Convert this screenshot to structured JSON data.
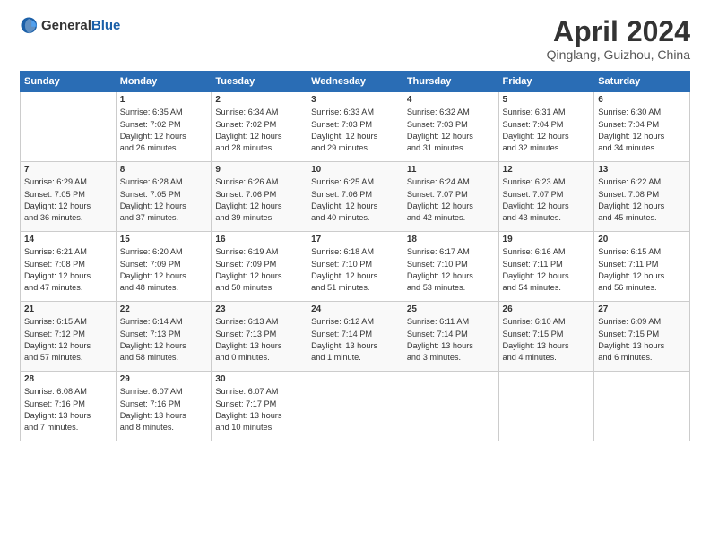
{
  "header": {
    "logo_general": "General",
    "logo_blue": "Blue",
    "title": "April 2024",
    "location": "Qinglang, Guizhou, China"
  },
  "columns": [
    "Sunday",
    "Monday",
    "Tuesday",
    "Wednesday",
    "Thursday",
    "Friday",
    "Saturday"
  ],
  "weeks": [
    {
      "days": [
        {
          "num": "",
          "info": ""
        },
        {
          "num": "1",
          "info": "Sunrise: 6:35 AM\nSunset: 7:02 PM\nDaylight: 12 hours\nand 26 minutes."
        },
        {
          "num": "2",
          "info": "Sunrise: 6:34 AM\nSunset: 7:02 PM\nDaylight: 12 hours\nand 28 minutes."
        },
        {
          "num": "3",
          "info": "Sunrise: 6:33 AM\nSunset: 7:03 PM\nDaylight: 12 hours\nand 29 minutes."
        },
        {
          "num": "4",
          "info": "Sunrise: 6:32 AM\nSunset: 7:03 PM\nDaylight: 12 hours\nand 31 minutes."
        },
        {
          "num": "5",
          "info": "Sunrise: 6:31 AM\nSunset: 7:04 PM\nDaylight: 12 hours\nand 32 minutes."
        },
        {
          "num": "6",
          "info": "Sunrise: 6:30 AM\nSunset: 7:04 PM\nDaylight: 12 hours\nand 34 minutes."
        }
      ]
    },
    {
      "days": [
        {
          "num": "7",
          "info": "Sunrise: 6:29 AM\nSunset: 7:05 PM\nDaylight: 12 hours\nand 36 minutes."
        },
        {
          "num": "8",
          "info": "Sunrise: 6:28 AM\nSunset: 7:05 PM\nDaylight: 12 hours\nand 37 minutes."
        },
        {
          "num": "9",
          "info": "Sunrise: 6:26 AM\nSunset: 7:06 PM\nDaylight: 12 hours\nand 39 minutes."
        },
        {
          "num": "10",
          "info": "Sunrise: 6:25 AM\nSunset: 7:06 PM\nDaylight: 12 hours\nand 40 minutes."
        },
        {
          "num": "11",
          "info": "Sunrise: 6:24 AM\nSunset: 7:07 PM\nDaylight: 12 hours\nand 42 minutes."
        },
        {
          "num": "12",
          "info": "Sunrise: 6:23 AM\nSunset: 7:07 PM\nDaylight: 12 hours\nand 43 minutes."
        },
        {
          "num": "13",
          "info": "Sunrise: 6:22 AM\nSunset: 7:08 PM\nDaylight: 12 hours\nand 45 minutes."
        }
      ]
    },
    {
      "days": [
        {
          "num": "14",
          "info": "Sunrise: 6:21 AM\nSunset: 7:08 PM\nDaylight: 12 hours\nand 47 minutes."
        },
        {
          "num": "15",
          "info": "Sunrise: 6:20 AM\nSunset: 7:09 PM\nDaylight: 12 hours\nand 48 minutes."
        },
        {
          "num": "16",
          "info": "Sunrise: 6:19 AM\nSunset: 7:09 PM\nDaylight: 12 hours\nand 50 minutes."
        },
        {
          "num": "17",
          "info": "Sunrise: 6:18 AM\nSunset: 7:10 PM\nDaylight: 12 hours\nand 51 minutes."
        },
        {
          "num": "18",
          "info": "Sunrise: 6:17 AM\nSunset: 7:10 PM\nDaylight: 12 hours\nand 53 minutes."
        },
        {
          "num": "19",
          "info": "Sunrise: 6:16 AM\nSunset: 7:11 PM\nDaylight: 12 hours\nand 54 minutes."
        },
        {
          "num": "20",
          "info": "Sunrise: 6:15 AM\nSunset: 7:11 PM\nDaylight: 12 hours\nand 56 minutes."
        }
      ]
    },
    {
      "days": [
        {
          "num": "21",
          "info": "Sunrise: 6:15 AM\nSunset: 7:12 PM\nDaylight: 12 hours\nand 57 minutes."
        },
        {
          "num": "22",
          "info": "Sunrise: 6:14 AM\nSunset: 7:13 PM\nDaylight: 12 hours\nand 58 minutes."
        },
        {
          "num": "23",
          "info": "Sunrise: 6:13 AM\nSunset: 7:13 PM\nDaylight: 13 hours\nand 0 minutes."
        },
        {
          "num": "24",
          "info": "Sunrise: 6:12 AM\nSunset: 7:14 PM\nDaylight: 13 hours\nand 1 minute."
        },
        {
          "num": "25",
          "info": "Sunrise: 6:11 AM\nSunset: 7:14 PM\nDaylight: 13 hours\nand 3 minutes."
        },
        {
          "num": "26",
          "info": "Sunrise: 6:10 AM\nSunset: 7:15 PM\nDaylight: 13 hours\nand 4 minutes."
        },
        {
          "num": "27",
          "info": "Sunrise: 6:09 AM\nSunset: 7:15 PM\nDaylight: 13 hours\nand 6 minutes."
        }
      ]
    },
    {
      "days": [
        {
          "num": "28",
          "info": "Sunrise: 6:08 AM\nSunset: 7:16 PM\nDaylight: 13 hours\nand 7 minutes."
        },
        {
          "num": "29",
          "info": "Sunrise: 6:07 AM\nSunset: 7:16 PM\nDaylight: 13 hours\nand 8 minutes."
        },
        {
          "num": "30",
          "info": "Sunrise: 6:07 AM\nSunset: 7:17 PM\nDaylight: 13 hours\nand 10 minutes."
        },
        {
          "num": "",
          "info": ""
        },
        {
          "num": "",
          "info": ""
        },
        {
          "num": "",
          "info": ""
        },
        {
          "num": "",
          "info": ""
        }
      ]
    }
  ]
}
